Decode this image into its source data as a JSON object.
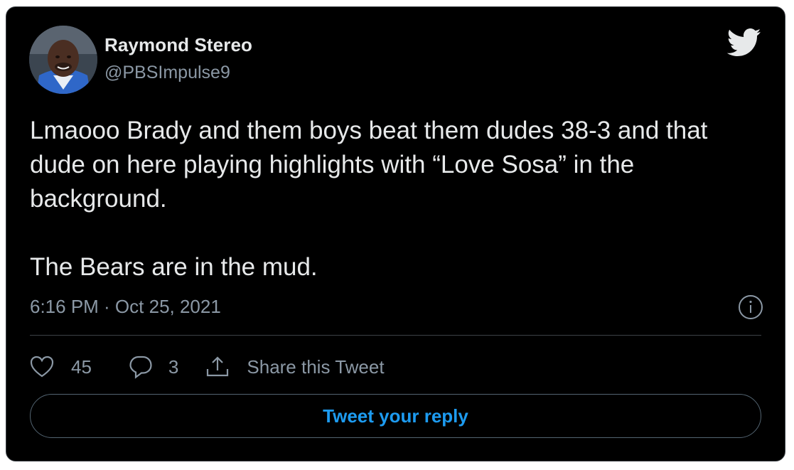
{
  "author": {
    "display_name": "Raymond Stereo",
    "handle": "@PBSImpulse9"
  },
  "tweet": {
    "text": "Lmaooo Brady and them boys beat them dudes 38-3 and that dude on here playing highlights with “Love Sosa” in the background.\n\nThe Bears are in the mud.",
    "timestamp": "6:16 PM · Oct 25, 2021"
  },
  "actions": {
    "likes": "45",
    "replies": "3",
    "share_label": "Share this Tweet"
  },
  "reply_button_label": "Tweet your reply",
  "icons": {
    "brand": "twitter-bird-icon",
    "info": "info-icon",
    "like": "heart-icon",
    "reply": "speech-bubble-icon",
    "share": "share-upload-icon"
  },
  "colors": {
    "background": "#000000",
    "border": "#3d4247",
    "primary_text": "#e7e9ea",
    "secondary_text": "#8b98a5",
    "accent": "#1d9bf0"
  }
}
